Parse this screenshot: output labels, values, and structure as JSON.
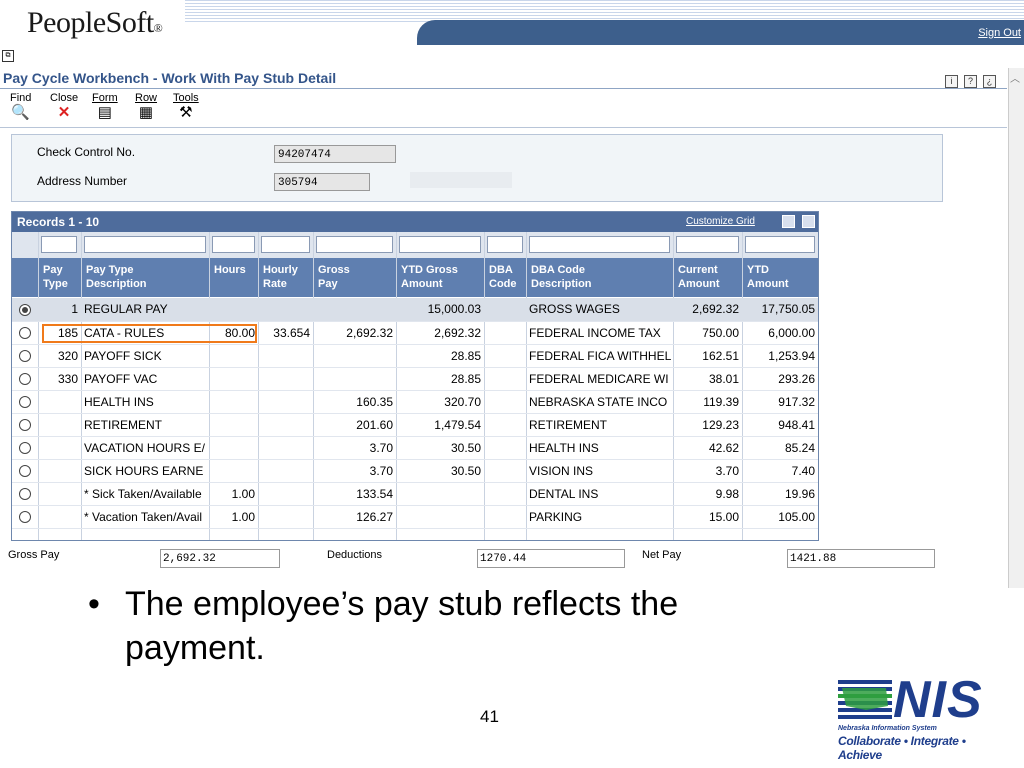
{
  "app": {
    "logo": "PeopleSoft",
    "logo_mark": "®",
    "sign_out": "Sign Out",
    "page_title": "Pay Cycle Workbench - Work With Pay Stub Detail"
  },
  "toolbar": {
    "items": [
      {
        "label": "Find",
        "icon": "find-icon"
      },
      {
        "label": "Close",
        "icon": "close-icon"
      },
      {
        "label": "Form",
        "icon": "form-icon"
      },
      {
        "label": "Row",
        "icon": "row-icon"
      },
      {
        "label": "Tools",
        "icon": "tools-icon"
      }
    ]
  },
  "header": {
    "check_control_label": "Check Control No.",
    "check_control_value": "94207474",
    "address_label": "Address Number",
    "address_value": "305794"
  },
  "grid": {
    "title": "Records 1 - 10",
    "customize": "Customize Grid",
    "columns": [
      "Pay Type",
      "Pay Type Description",
      "Hours",
      "Hourly Rate",
      "Gross Pay",
      "YTD Gross Amount",
      "DBA Code",
      "DBA Code Description",
      "Current Amount",
      "YTD Amount"
    ],
    "rows": [
      {
        "selected": true,
        "pay_type": "1",
        "desc": "REGULAR PAY",
        "hours": "",
        "rate": "",
        "gross": "",
        "ytd_gross": "15,000.03",
        "dba": "",
        "dba_desc": "GROSS WAGES",
        "current": "2,692.32",
        "ytd": "17,750.05"
      },
      {
        "selected": false,
        "pay_type": "185",
        "desc": "CATA - RULES",
        "hours": "80.00",
        "rate": "33.654",
        "gross": "2,692.32",
        "ytd_gross": "2,692.32",
        "dba": "",
        "dba_desc": "FEDERAL INCOME TAX",
        "current": "750.00",
        "ytd": "6,000.00"
      },
      {
        "selected": false,
        "pay_type": "320",
        "desc": "PAYOFF SICK",
        "hours": "",
        "rate": "",
        "gross": "",
        "ytd_gross": "28.85",
        "dba": "",
        "dba_desc": "FEDERAL FICA WITHHEL",
        "current": "162.51",
        "ytd": "1,253.94"
      },
      {
        "selected": false,
        "pay_type": "330",
        "desc": "PAYOFF VAC",
        "hours": "",
        "rate": "",
        "gross": "",
        "ytd_gross": "28.85",
        "dba": "",
        "dba_desc": "FEDERAL MEDICARE WI",
        "current": "38.01",
        "ytd": "293.26"
      },
      {
        "selected": false,
        "pay_type": "",
        "desc": "HEALTH INS",
        "hours": "",
        "rate": "",
        "gross": "160.35",
        "ytd_gross": "320.70",
        "dba": "",
        "dba_desc": "NEBRASKA STATE INCO",
        "current": "119.39",
        "ytd": "917.32"
      },
      {
        "selected": false,
        "pay_type": "",
        "desc": "RETIREMENT",
        "hours": "",
        "rate": "",
        "gross": "201.60",
        "ytd_gross": "1,479.54",
        "dba": "",
        "dba_desc": "RETIREMENT",
        "current": "129.23",
        "ytd": "948.41"
      },
      {
        "selected": false,
        "pay_type": "",
        "desc": "VACATION HOURS E/",
        "hours": "",
        "rate": "",
        "gross": "3.70",
        "ytd_gross": "30.50",
        "dba": "",
        "dba_desc": "HEALTH INS",
        "current": "42.62",
        "ytd": "85.24"
      },
      {
        "selected": false,
        "pay_type": "",
        "desc": "SICK HOURS EARNE",
        "hours": "",
        "rate": "",
        "gross": "3.70",
        "ytd_gross": "30.50",
        "dba": "",
        "dba_desc": "VISION INS",
        "current": "3.70",
        "ytd": "7.40"
      },
      {
        "selected": false,
        "pay_type": "",
        "desc": "* Sick Taken/Available",
        "hours": "1.00",
        "rate": "",
        "gross": "133.54",
        "ytd_gross": "",
        "dba": "",
        "dba_desc": "DENTAL INS",
        "current": "9.98",
        "ytd": "19.96"
      },
      {
        "selected": false,
        "pay_type": "",
        "desc": "* Vacation Taken/Avail",
        "hours": "1.00",
        "rate": "",
        "gross": "126.27",
        "ytd_gross": "",
        "dba": "",
        "dba_desc": "PARKING",
        "current": "15.00",
        "ytd": "105.00"
      }
    ]
  },
  "totals": {
    "gross_label": "Gross Pay",
    "gross_value": "2,692.32",
    "deductions_label": "Deductions",
    "deductions_value": "1270.44",
    "net_label": "Net Pay",
    "net_value": "1421.88"
  },
  "slide": {
    "bullet": "•",
    "text": "The employee’s pay stub reflects the payment.",
    "page_number": "41"
  },
  "nis": {
    "name": "NIS",
    "subtitle": "Nebraska Information System",
    "tagline": "Collaborate • Integrate • Achieve",
    "brand_color": "#1f3e8c",
    "accent_color": "#2e9e3f"
  }
}
